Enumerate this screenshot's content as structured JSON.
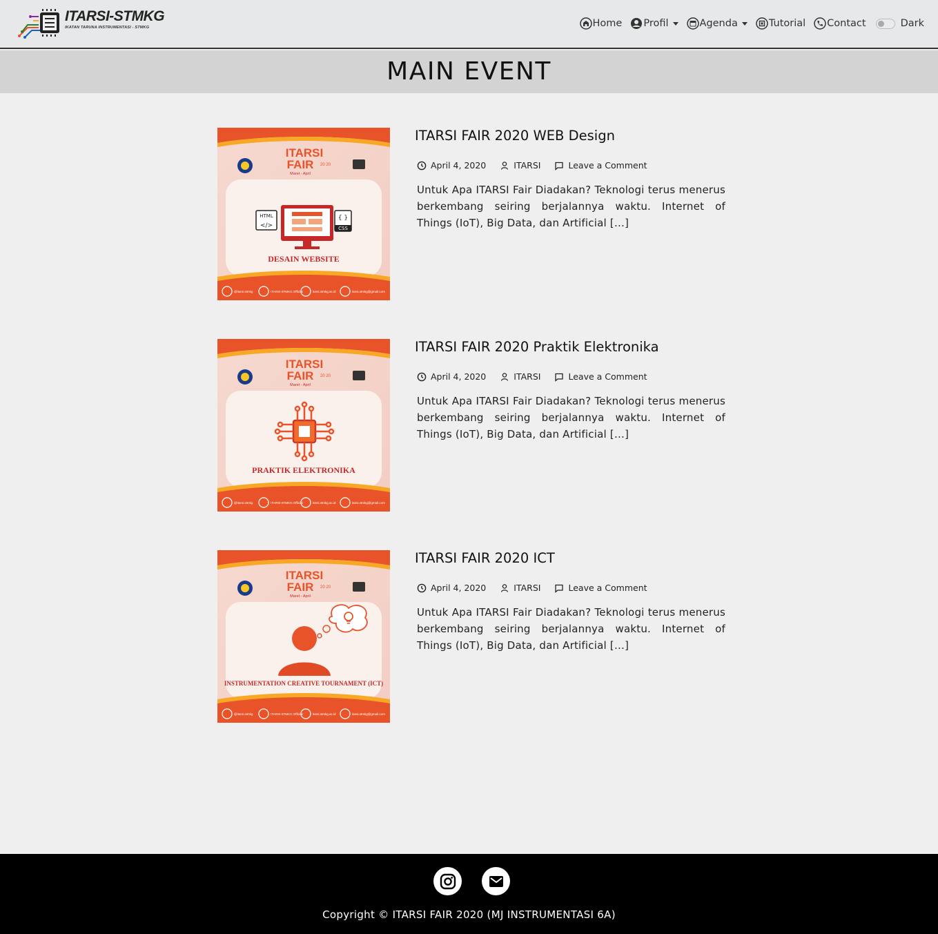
{
  "navbar": {
    "logo_title": "ITARSI-STMKG",
    "logo_subtitle": "IKATAN TARUNA INSTRUMENTASI - STMKG",
    "items": [
      {
        "label": "Home",
        "icon": "home-icon",
        "dropdown": false
      },
      {
        "label": "Profil",
        "icon": "user-circle-icon",
        "dropdown": true
      },
      {
        "label": "Agenda",
        "icon": "calendar-icon",
        "dropdown": true
      },
      {
        "label": "Tutorial",
        "icon": "chip-icon",
        "dropdown": false
      },
      {
        "label": "Contact",
        "icon": "phone-icon",
        "dropdown": false
      }
    ],
    "dark_label": "Dark"
  },
  "page": {
    "title": "MAIN EVENT"
  },
  "posts": [
    {
      "title": "ITARSI FAIR 2020 WEB Design",
      "date": "April 4, 2020",
      "author": "ITARSI",
      "comment": "Leave a Comment",
      "excerpt": "Untuk Apa ITARSI Fair Diadakan? Teknologi terus menerus berkembang seiring berjalannya waktu. Internet of Things (IoT), Big Data, dan Artificial […]",
      "thumb_logo": "ITARSI",
      "thumb_logo2": "FAIR",
      "thumb_year": "20 20",
      "thumb_date": "Maret - April",
      "thumb_caption": "DESAIN WEBSITE",
      "thumb_html": "HTML",
      "thumb_css": "CSS",
      "thumb_footer": [
        "@itarsi.stmkg",
        "ITARSI-STMKG Official",
        "itarsi.stmkg.ac.id",
        "itarsi.stmkg@gmail.com"
      ]
    },
    {
      "title": "ITARSI FAIR 2020 Praktik Elektronika",
      "date": "April 4, 2020",
      "author": "ITARSI",
      "comment": "Leave a Comment",
      "excerpt": "Untuk Apa ITARSI Fair Diadakan? Teknologi terus menerus berkembang seiring berjalannya waktu. Internet of Things (IoT), Big Data, dan Artificial […]",
      "thumb_logo": "ITARSI",
      "thumb_logo2": "FAIR",
      "thumb_year": "20 20",
      "thumb_date": "Maret - April",
      "thumb_caption": "PRAKTIK ELEKTRONIKA",
      "thumb_footer": [
        "@itarsi.stmkg",
        "ITARSI-STMKG Official",
        "itarsi.stmkg.ac.id",
        "itarsi.stmkg@gmail.com"
      ]
    },
    {
      "title": "ITARSI FAIR 2020 ICT",
      "date": "April 4, 2020",
      "author": "ITARSI",
      "comment": "Leave a Comment",
      "excerpt": "Untuk Apa ITARSI Fair Diadakan? Teknologi terus menerus berkembang seiring berjalannya waktu. Internet of Things (IoT), Big Data, dan Artificial […]",
      "thumb_logo": "ITARSI",
      "thumb_logo2": "FAIR",
      "thumb_year": "20 20",
      "thumb_date": "Maret - April",
      "thumb_caption": "INSTRUMENTATION CREATIVE TOURNAMENT (ICT)",
      "thumb_footer": [
        "@itarsi.stmkg",
        "ITARSI-STMKG Official",
        "itarsi.stmkg.ac.id",
        "itarsi.stmkg@gmail.com"
      ]
    }
  ],
  "footer": {
    "social": [
      "instagram-icon",
      "mail-icon"
    ],
    "copyright": "Copyright © ITARSI FAIR 2020 (MJ INSTRUMENTASI 6A)"
  },
  "colors": {
    "navbar_bg": "#e6e8e9",
    "banner_bg": "#d3d3d3",
    "page_bg": "#efefef",
    "footer_bg": "#000000",
    "thumb_orange": "#e8532a",
    "thumb_red": "#c62828"
  }
}
